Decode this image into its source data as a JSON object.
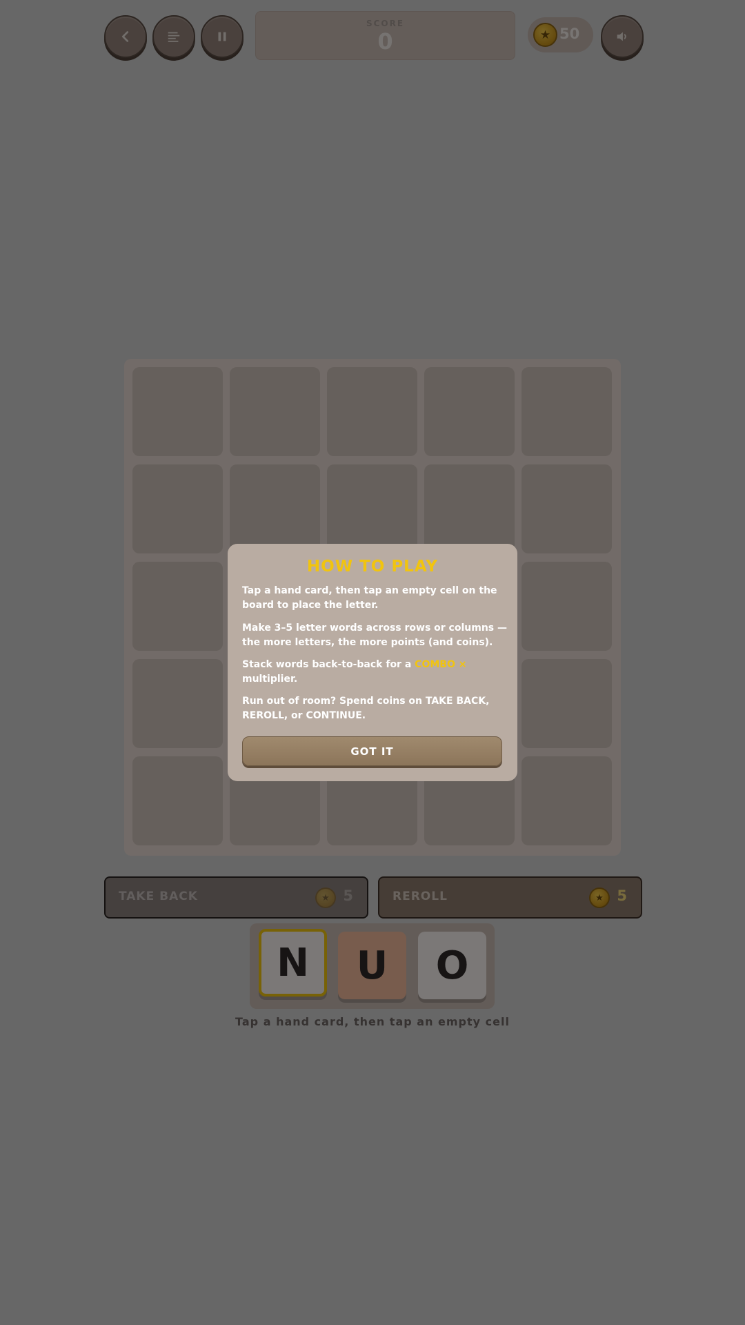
{
  "header": {
    "score_label": "SCORE",
    "score_value": "0",
    "coins": "50",
    "icons": [
      "back-icon",
      "menu-icon",
      "pause-icon",
      "coin-icon",
      "sound-icon"
    ]
  },
  "powerups": {
    "take_back": {
      "label": "TAKE BACK",
      "cost": "5"
    },
    "reroll": {
      "label": "REROLL",
      "cost": "5"
    }
  },
  "hand": {
    "cards": [
      {
        "letter": "N",
        "selected": true,
        "color": "#f6f1ee"
      },
      {
        "letter": "U",
        "selected": false,
        "color": "#f0b89a"
      },
      {
        "letter": "O",
        "selected": false,
        "color": "#f6f1ee"
      }
    ],
    "hint": "Tap a hand card, then tap an empty cell"
  },
  "board": {
    "rows": 5,
    "cols": 5
  },
  "modal": {
    "title": "HOW TO PLAY",
    "p1": "Tap a hand card, then tap an empty cell on the board to place the letter.",
    "p2": "Make 3–5 letter words across rows or columns — the more letters, the more points (and coins).",
    "p3_before": "Stack words back-to-back for a ",
    "p3_highlight": "COMBO ×",
    "p3_after": " multiplier.",
    "p4": "Run out of room? Spend coins on TAKE BACK, REROLL, or CONTINUE.",
    "button": "GOT IT"
  },
  "colors": {
    "accent": "#f1c40f",
    "button_brown": "#94837a",
    "card_highlight": "#f0b89a"
  }
}
